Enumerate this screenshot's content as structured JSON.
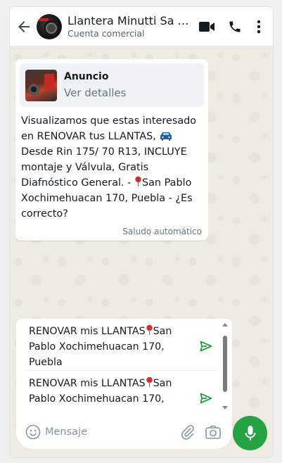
{
  "header": {
    "title": "Llantera Minutti Sa D…",
    "subtitle": "Cuenta comercial",
    "icons": [
      "back-arrow-icon",
      "video-call-icon",
      "phone-icon",
      "more-vert-icon"
    ]
  },
  "message": {
    "ad_label": "Anuncio",
    "ad_link": "Ver detalles",
    "text_part1": "Visualizamos que estas interesado en RENOVAR tus LLANTAS, ",
    "text_part2": "\nDesde Rin 175/ 70 R13, INCLUYE montaje y Válvula, Gratis Diafnóstico General. - ",
    "text_part3": "San Pablo Xochimehuacan 170, Puebla - ¿Es correcto?",
    "meta": "Saludo automático"
  },
  "quick_replies": [
    {
      "before_pin": "RENOVAR mis LLANTAS",
      "after_pin": "San Pablo Xochimehuacan 170, Puebla"
    },
    {
      "before_pin": "RENOVAR mis LLANTAS",
      "after_pin": "San Pablo Xochimehuacan 170,"
    }
  ],
  "composer": {
    "placeholder": "Mensaje"
  },
  "colors": {
    "accent": "#25a244",
    "chat_bg": "#efeae2",
    "pin": "#d32f2f",
    "ad_card_bg": "#f0f2f5"
  }
}
